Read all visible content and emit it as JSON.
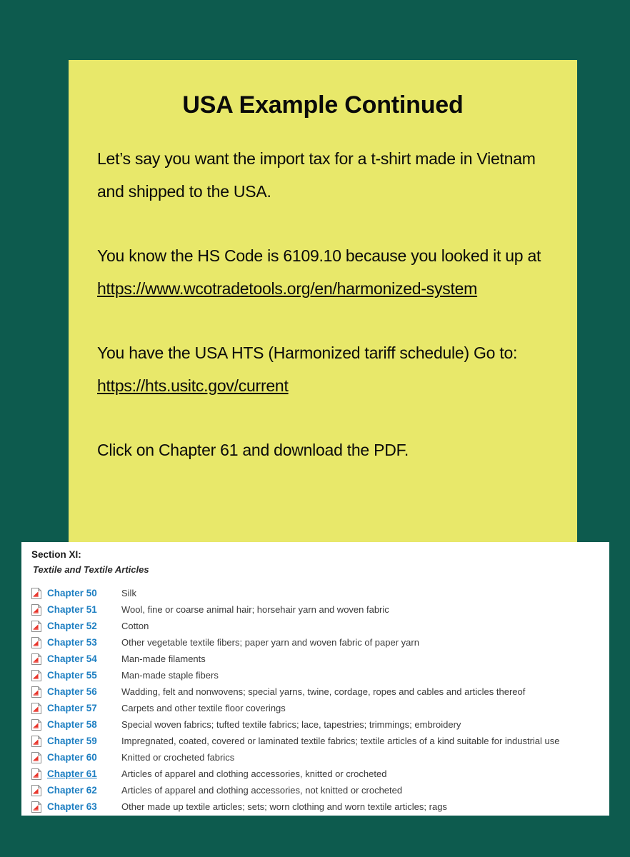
{
  "colors": {
    "background": "#0d5b4e",
    "slide_panel": "#e8e86a",
    "listing_panel": "#ffffff",
    "link_blue": "#1e7fc2",
    "text_black": "#0a0a0a"
  },
  "slide": {
    "title": "USA Example Continued",
    "paragraphs": [
      {
        "id": "intro",
        "segments": [
          {
            "type": "text",
            "value": "Let’s say you want the import tax for a t-shirt made in Vietnam and shipped to the USA."
          }
        ]
      },
      {
        "id": "hs-code",
        "segments": [
          {
            "type": "text",
            "value": "You know the HS Code is 6109.10 because you looked it up at "
          },
          {
            "type": "link",
            "value": "https://www.wcotradetools.org/en/harmonized-system"
          }
        ]
      },
      {
        "id": "hts-schedule",
        "segments": [
          {
            "type": "text",
            "value": "You have the USA HTS (Harmonized tariff schedule) Go to: "
          },
          {
            "type": "link",
            "value": "https://hts.usitc.gov/current"
          }
        ]
      },
      {
        "id": "instruction",
        "segments": [
          {
            "type": "text",
            "value": "Click on Chapter 61 and download the PDF."
          }
        ]
      }
    ]
  },
  "hts_listing": {
    "section_heading": "Section XI:",
    "section_subheading": "Textile and Textile Articles",
    "icon_name": "pdf-file-icon",
    "chapters": [
      {
        "label": "Chapter 50",
        "description": "Silk",
        "active": false
      },
      {
        "label": "Chapter 51",
        "description": "Wool, fine or coarse animal hair; horsehair yarn and woven fabric",
        "active": false
      },
      {
        "label": "Chapter 52",
        "description": "Cotton",
        "active": false
      },
      {
        "label": "Chapter 53",
        "description": "Other vegetable textile fibers; paper yarn and woven fabric of paper yarn",
        "active": false
      },
      {
        "label": "Chapter 54",
        "description": "Man-made filaments",
        "active": false
      },
      {
        "label": "Chapter 55",
        "description": "Man-made staple fibers",
        "active": false
      },
      {
        "label": "Chapter 56",
        "description": "Wadding, felt and nonwovens; special yarns, twine, cordage, ropes and cables and articles thereof",
        "active": false
      },
      {
        "label": "Chapter 57",
        "description": "Carpets and other textile floor coverings",
        "active": false
      },
      {
        "label": "Chapter 58",
        "description": "Special woven fabrics; tufted textile fabrics; lace, tapestries; trimmings; embroidery",
        "active": false
      },
      {
        "label": "Chapter 59",
        "description": "Impregnated, coated, covered or laminated textile fabrics; textile articles of a kind suitable for industrial use",
        "active": false
      },
      {
        "label": "Chapter 60",
        "description": "Knitted or crocheted fabrics",
        "active": false
      },
      {
        "label": "Chapter 61",
        "description": "Articles of apparel and clothing accessories, knitted or crocheted",
        "active": true
      },
      {
        "label": "Chapter 62",
        "description": "Articles of apparel and clothing accessories, not knitted or crocheted",
        "active": false
      },
      {
        "label": "Chapter 63",
        "description": "Other made up textile articles; sets; worn clothing and worn textile articles; rags",
        "active": false
      }
    ]
  }
}
